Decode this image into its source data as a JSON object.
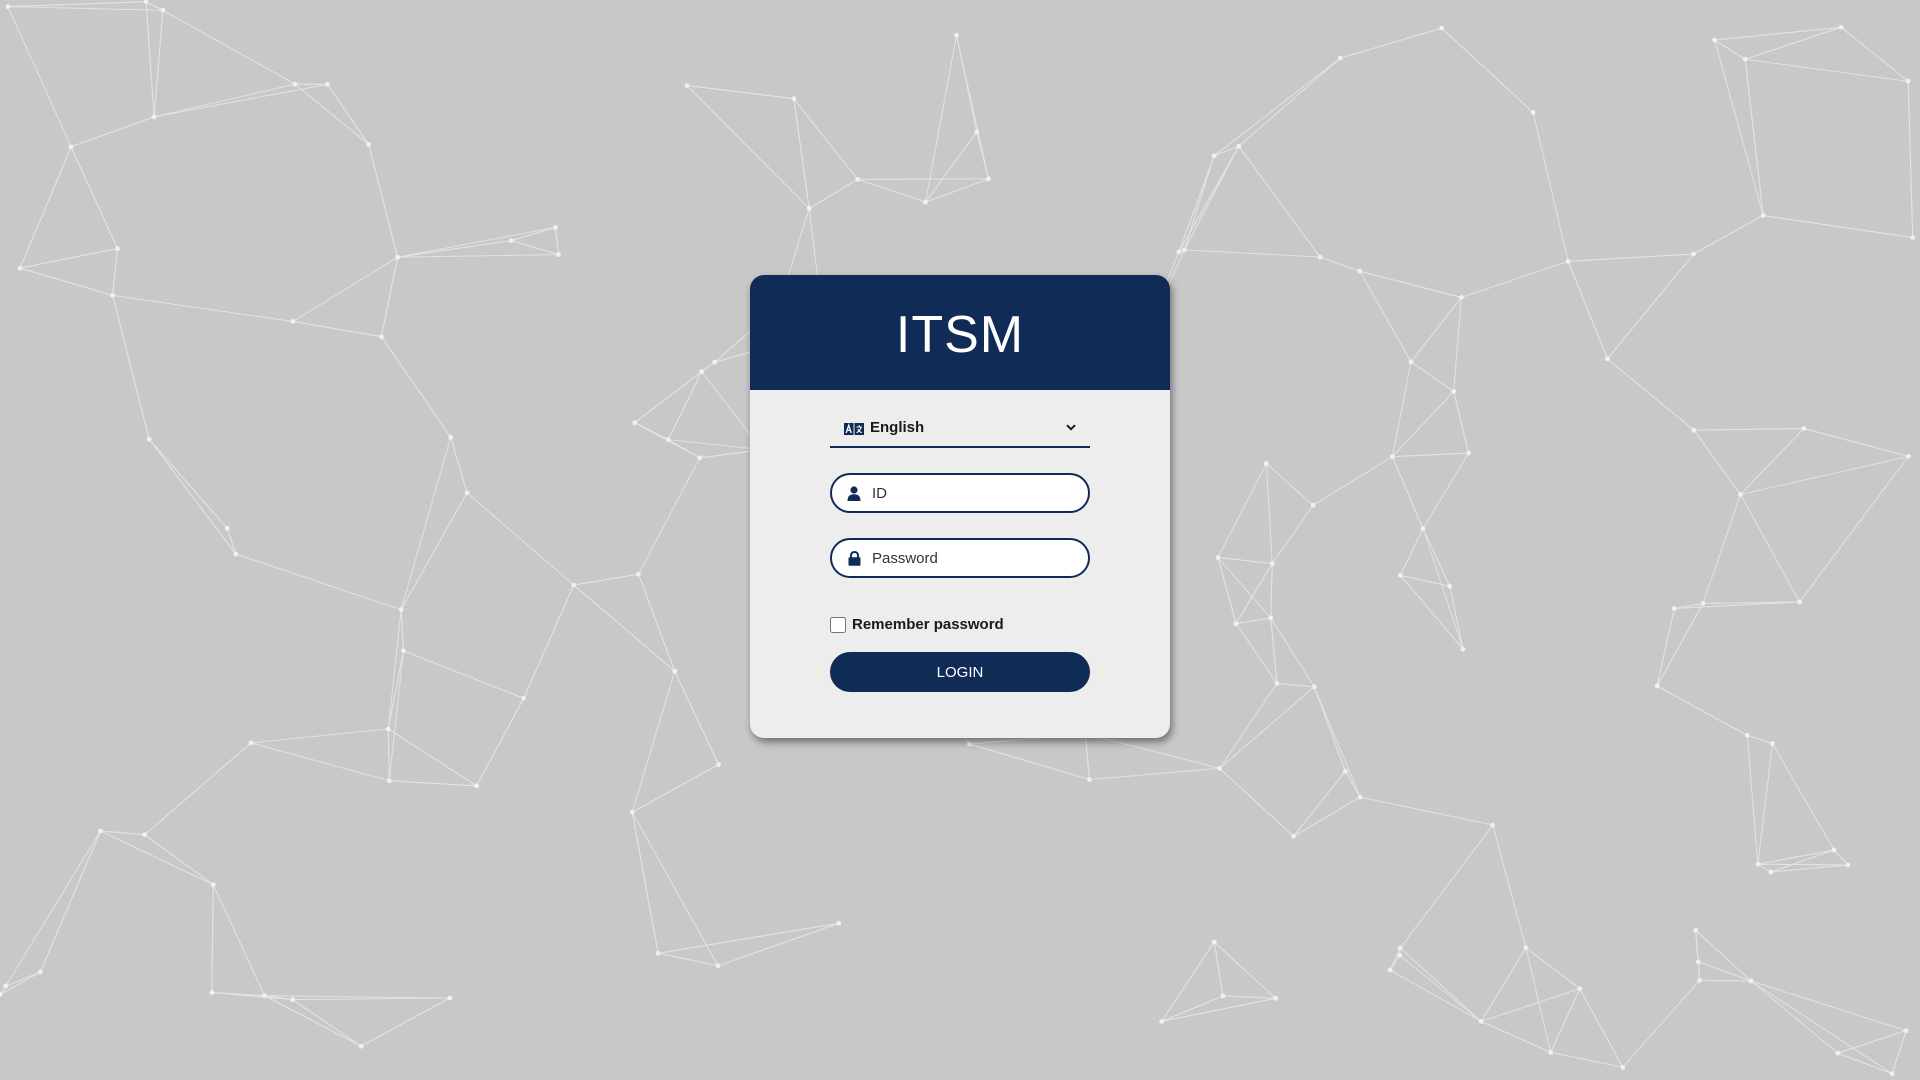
{
  "background": {
    "color": "#c8c8c8",
    "line_color": "#e2e2e2",
    "node_color": "#f0f0f0"
  },
  "card": {
    "title": "ITSM",
    "header_color": "#112b57"
  },
  "language": {
    "icon": "translate-icon",
    "selected": "English",
    "chevron_icon": "chevron-down-icon"
  },
  "form": {
    "id_placeholder": "ID",
    "id_icon": "user-icon",
    "password_placeholder": "Password",
    "password_icon": "lock-icon",
    "remember_label": "Remember password",
    "remember_checked": false,
    "login_label": "LOGIN"
  }
}
